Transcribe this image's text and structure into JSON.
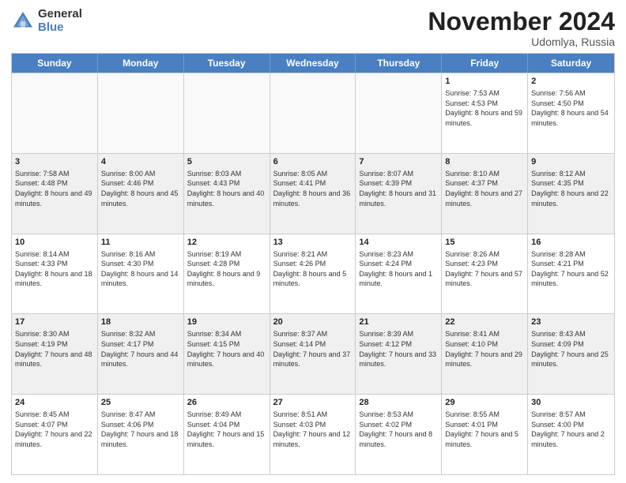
{
  "header": {
    "logo_general": "General",
    "logo_blue": "Blue",
    "month_title": "November 2024",
    "location": "Udomlya, Russia"
  },
  "days_of_week": [
    "Sunday",
    "Monday",
    "Tuesday",
    "Wednesday",
    "Thursday",
    "Friday",
    "Saturday"
  ],
  "weeks": [
    [
      {
        "day": "",
        "info": "",
        "empty": true
      },
      {
        "day": "",
        "info": "",
        "empty": true
      },
      {
        "day": "",
        "info": "",
        "empty": true
      },
      {
        "day": "",
        "info": "",
        "empty": true
      },
      {
        "day": "",
        "info": "",
        "empty": true
      },
      {
        "day": "1",
        "info": "Sunrise: 7:53 AM\nSunset: 4:53 PM\nDaylight: 8 hours and 59 minutes.",
        "empty": false
      },
      {
        "day": "2",
        "info": "Sunrise: 7:56 AM\nSunset: 4:50 PM\nDaylight: 8 hours and 54 minutes.",
        "empty": false
      }
    ],
    [
      {
        "day": "3",
        "info": "Sunrise: 7:58 AM\nSunset: 4:48 PM\nDaylight: 8 hours and 49 minutes.",
        "empty": false
      },
      {
        "day": "4",
        "info": "Sunrise: 8:00 AM\nSunset: 4:46 PM\nDaylight: 8 hours and 45 minutes.",
        "empty": false
      },
      {
        "day": "5",
        "info": "Sunrise: 8:03 AM\nSunset: 4:43 PM\nDaylight: 8 hours and 40 minutes.",
        "empty": false
      },
      {
        "day": "6",
        "info": "Sunrise: 8:05 AM\nSunset: 4:41 PM\nDaylight: 8 hours and 36 minutes.",
        "empty": false
      },
      {
        "day": "7",
        "info": "Sunrise: 8:07 AM\nSunset: 4:39 PM\nDaylight: 8 hours and 31 minutes.",
        "empty": false
      },
      {
        "day": "8",
        "info": "Sunrise: 8:10 AM\nSunset: 4:37 PM\nDaylight: 8 hours and 27 minutes.",
        "empty": false
      },
      {
        "day": "9",
        "info": "Sunrise: 8:12 AM\nSunset: 4:35 PM\nDaylight: 8 hours and 22 minutes.",
        "empty": false
      }
    ],
    [
      {
        "day": "10",
        "info": "Sunrise: 8:14 AM\nSunset: 4:33 PM\nDaylight: 8 hours and 18 minutes.",
        "empty": false
      },
      {
        "day": "11",
        "info": "Sunrise: 8:16 AM\nSunset: 4:30 PM\nDaylight: 8 hours and 14 minutes.",
        "empty": false
      },
      {
        "day": "12",
        "info": "Sunrise: 8:19 AM\nSunset: 4:28 PM\nDaylight: 8 hours and 9 minutes.",
        "empty": false
      },
      {
        "day": "13",
        "info": "Sunrise: 8:21 AM\nSunset: 4:26 PM\nDaylight: 8 hours and 5 minutes.",
        "empty": false
      },
      {
        "day": "14",
        "info": "Sunrise: 8:23 AM\nSunset: 4:24 PM\nDaylight: 8 hours and 1 minute.",
        "empty": false
      },
      {
        "day": "15",
        "info": "Sunrise: 8:26 AM\nSunset: 4:23 PM\nDaylight: 7 hours and 57 minutes.",
        "empty": false
      },
      {
        "day": "16",
        "info": "Sunrise: 8:28 AM\nSunset: 4:21 PM\nDaylight: 7 hours and 52 minutes.",
        "empty": false
      }
    ],
    [
      {
        "day": "17",
        "info": "Sunrise: 8:30 AM\nSunset: 4:19 PM\nDaylight: 7 hours and 48 minutes.",
        "empty": false
      },
      {
        "day": "18",
        "info": "Sunrise: 8:32 AM\nSunset: 4:17 PM\nDaylight: 7 hours and 44 minutes.",
        "empty": false
      },
      {
        "day": "19",
        "info": "Sunrise: 8:34 AM\nSunset: 4:15 PM\nDaylight: 7 hours and 40 minutes.",
        "empty": false
      },
      {
        "day": "20",
        "info": "Sunrise: 8:37 AM\nSunset: 4:14 PM\nDaylight: 7 hours and 37 minutes.",
        "empty": false
      },
      {
        "day": "21",
        "info": "Sunrise: 8:39 AM\nSunset: 4:12 PM\nDaylight: 7 hours and 33 minutes.",
        "empty": false
      },
      {
        "day": "22",
        "info": "Sunrise: 8:41 AM\nSunset: 4:10 PM\nDaylight: 7 hours and 29 minutes.",
        "empty": false
      },
      {
        "day": "23",
        "info": "Sunrise: 8:43 AM\nSunset: 4:09 PM\nDaylight: 7 hours and 25 minutes.",
        "empty": false
      }
    ],
    [
      {
        "day": "24",
        "info": "Sunrise: 8:45 AM\nSunset: 4:07 PM\nDaylight: 7 hours and 22 minutes.",
        "empty": false
      },
      {
        "day": "25",
        "info": "Sunrise: 8:47 AM\nSunset: 4:06 PM\nDaylight: 7 hours and 18 minutes.",
        "empty": false
      },
      {
        "day": "26",
        "info": "Sunrise: 8:49 AM\nSunset: 4:04 PM\nDaylight: 7 hours and 15 minutes.",
        "empty": false
      },
      {
        "day": "27",
        "info": "Sunrise: 8:51 AM\nSunset: 4:03 PM\nDaylight: 7 hours and 12 minutes.",
        "empty": false
      },
      {
        "day": "28",
        "info": "Sunrise: 8:53 AM\nSunset: 4:02 PM\nDaylight: 7 hours and 8 minutes.",
        "empty": false
      },
      {
        "day": "29",
        "info": "Sunrise: 8:55 AM\nSunset: 4:01 PM\nDaylight: 7 hours and 5 minutes.",
        "empty": false
      },
      {
        "day": "30",
        "info": "Sunrise: 8:57 AM\nSunset: 4:00 PM\nDaylight: 7 hours and 2 minutes.",
        "empty": false
      }
    ]
  ]
}
